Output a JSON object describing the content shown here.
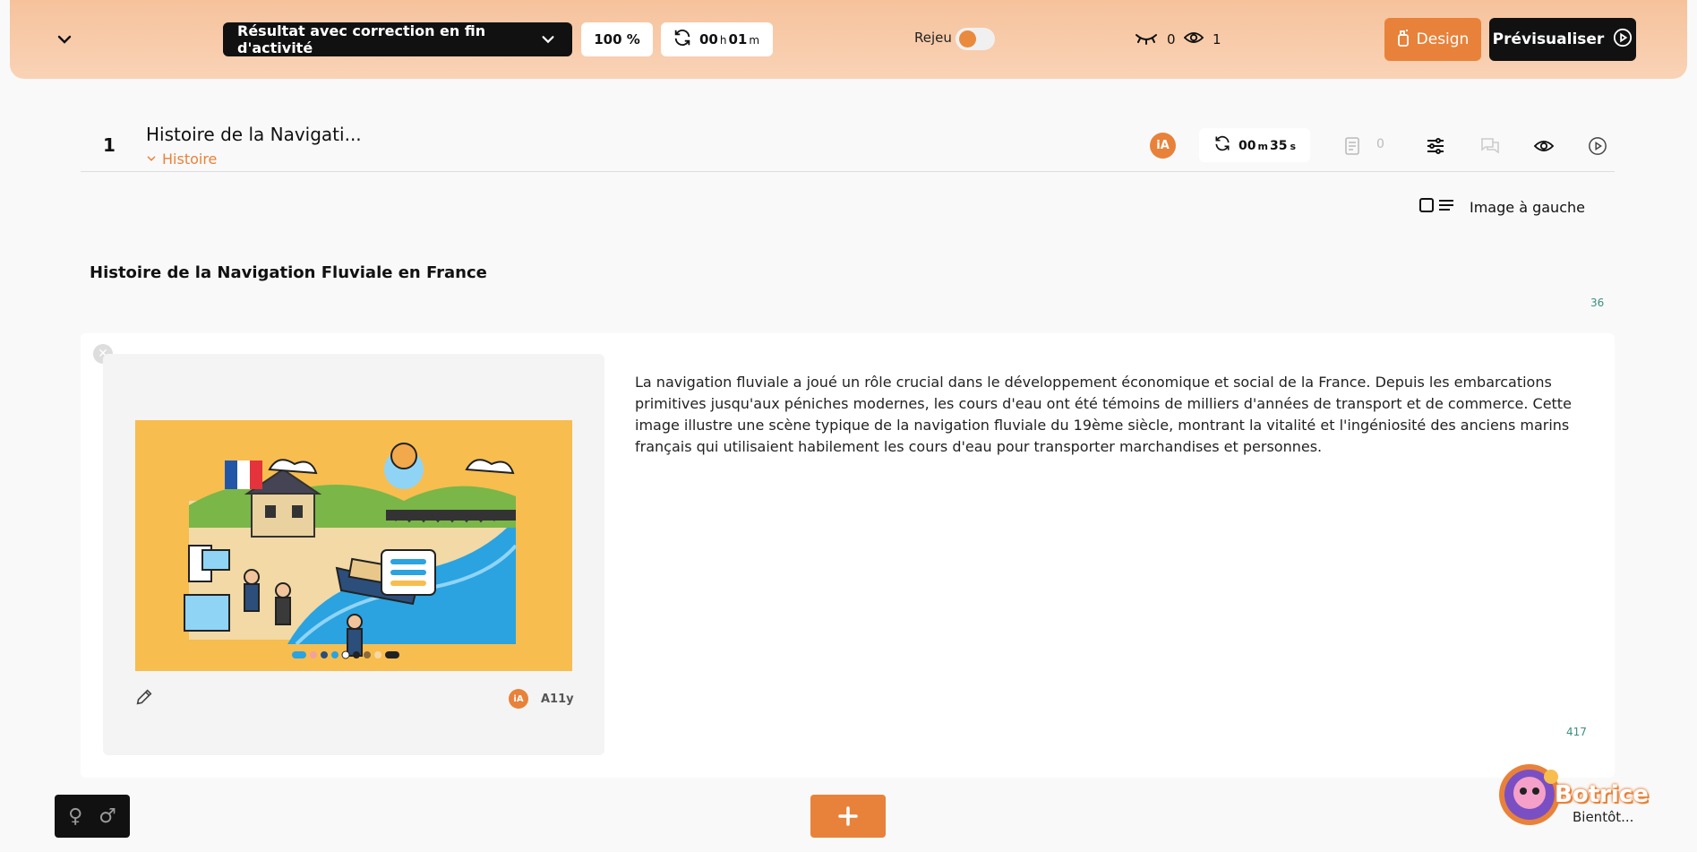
{
  "topbar": {
    "mode_select": "Résultat avec correction en fin d'activité",
    "percent": "100 %",
    "timer": {
      "h": "00",
      "h_unit": "h",
      "m": "01",
      "m_unit": "m"
    },
    "rejeu_label": "Rejeu",
    "rejeu_on": false,
    "hidden_count": "0",
    "visible_count": "1",
    "design_label": "Design",
    "preview_label": "Prévisualiser"
  },
  "slide": {
    "number": "1",
    "title": "Histoire de la Navigati...",
    "tag": "Histoire",
    "ia_label": "iA",
    "timer": {
      "m": "00",
      "m_unit": "m",
      "s": "35",
      "s_unit": "s"
    },
    "doc_count": "0"
  },
  "layout_option": "Image à gauche",
  "document": {
    "title": "Histoire de la Navigation Fluviale en France",
    "title_char_count": "36",
    "paragraph": "La navigation fluviale a joué un rôle crucial dans le développement économique et social de la France. Depuis les embarcations primitives jusqu'aux péniches modernes, les cours d'eau ont été témoins de milliers d'années de transport et de commerce. Cette image illustre une scène typique de la navigation fluviale du 19ème siècle, montrant la vitalité et l'ingéniosité des anciens marins français qui utilisaient habilement les cours d'eau pour transporter marchandises et personnes.",
    "paragraph_char_count": "417",
    "image_ia": "iA",
    "a11y_label": "A11y"
  },
  "footer": {
    "female_symbol": "♀",
    "male_symbol": "♂",
    "add_symbol": "+"
  },
  "assistant": {
    "name": "Botrice",
    "status": "Bientôt..."
  },
  "colors": {
    "accent": "#e8823a",
    "dark": "#111111",
    "topbar": "#f6c29c"
  }
}
